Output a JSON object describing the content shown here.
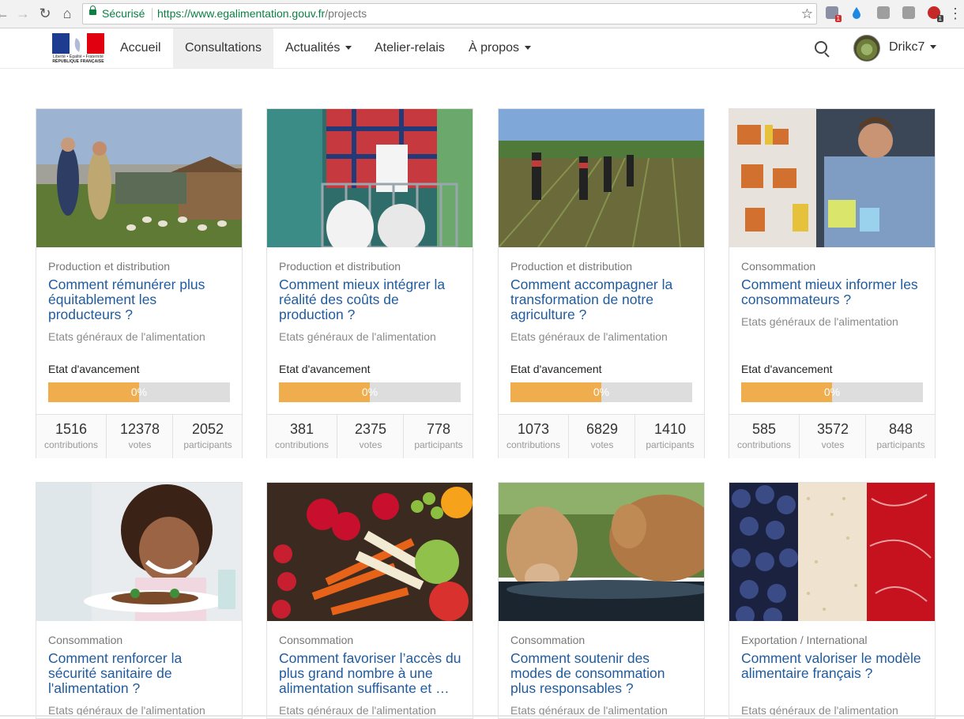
{
  "browser": {
    "secure_label": "Sécurisé",
    "url_host": "https://www.egalimentation.gouv.fr",
    "url_path": "/projects"
  },
  "header": {
    "logo_text_top": "Liberté • Égalité • Fraternité",
    "logo_text_bottom": "RÉPUBLIQUE FRANÇAISE",
    "nav": {
      "home": "Accueil",
      "consultations": "Consultations",
      "news": "Actualités",
      "workshop": "Atelier-relais",
      "about": "À propos"
    },
    "username": "Drikc7"
  },
  "progress_label": "Etat d'avancement",
  "stat_labels": {
    "contributions": "contributions",
    "votes": "votes",
    "participants": "participants"
  },
  "cards": [
    {
      "category": "Production et distribution",
      "title": "Comment rémunérer plus équitablement les producteurs ?",
      "subtitle": "Etats généraux de l'alimentation",
      "progress": "0%",
      "progress_fill": 0.5,
      "contributions": "1516",
      "votes": "12378",
      "participants": "2052"
    },
    {
      "category": "Production et distribution",
      "title": "Comment mieux intégrer la réalité des coûts de production ?",
      "subtitle": "Etats généraux de l'alimentation",
      "progress": "0%",
      "progress_fill": 0.5,
      "contributions": "381",
      "votes": "2375",
      "participants": "778"
    },
    {
      "category": "Production et distribution",
      "title": "Comment accompagner la transformation de notre agriculture ?",
      "subtitle": "Etats généraux de l'alimentation",
      "progress": "0%",
      "progress_fill": 0.5,
      "contributions": "1073",
      "votes": "6829",
      "participants": "1410"
    },
    {
      "category": "Consommation",
      "title": "Comment mieux informer les consommateurs ?",
      "subtitle": "Etats généraux de l'alimentation",
      "progress": "0%",
      "progress_fill": 0.5,
      "contributions": "585",
      "votes": "3572",
      "participants": "848"
    },
    {
      "category": "Consommation",
      "title": "Comment renforcer la sécurité sanitaire de l'alimentation ?",
      "subtitle": "Etats généraux de l'alimentation"
    },
    {
      "category": "Consommation",
      "title": "Comment favoriser l’accès du plus grand nombre à une alimentation suffisante et …",
      "subtitle": "Etats généraux de l'alimentation"
    },
    {
      "category": "Consommation",
      "title": "Comment soutenir des modes de consommation plus responsables ?",
      "subtitle": "Etats généraux de l'alimentation"
    },
    {
      "category": "Exportation / International",
      "title": "Comment valoriser le modèle alimentaire français ?",
      "subtitle": "Etats généraux de l'alimentation"
    }
  ]
}
